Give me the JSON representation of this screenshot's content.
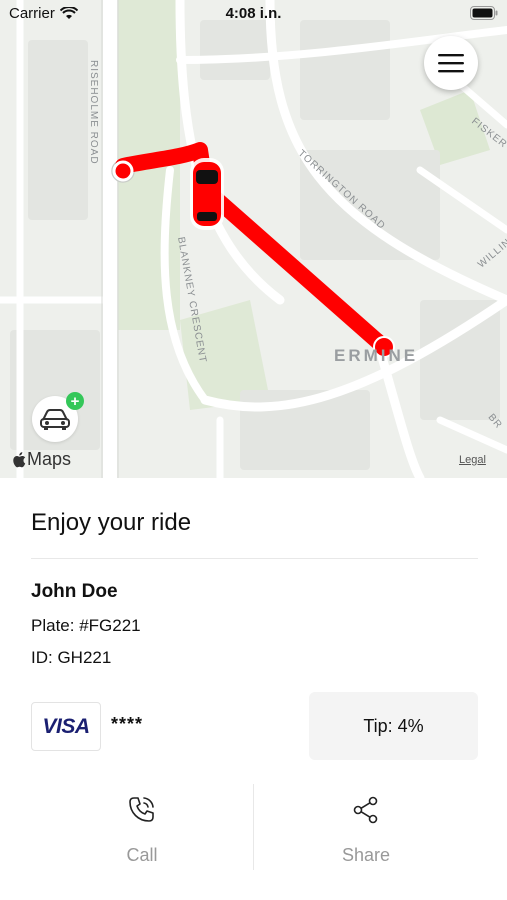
{
  "status_bar": {
    "carrier": "Carrier",
    "time": "4:08 i.n."
  },
  "map": {
    "streets": {
      "risholme": "RISEHOLME ROAD",
      "torrington": "TORRINGTON ROAD",
      "blankney": "BLANKNEY CRESCENT",
      "fiskerton": "FISKER",
      "willingham": "WILLING",
      "cut": "BR"
    },
    "area_label": "ERMINE",
    "maps_logo_text": "Maps",
    "legal_link": "Legal",
    "route_color": "#ff0000"
  },
  "ride": {
    "title": "Enjoy your ride",
    "driver_name": "John Doe",
    "plate_label": "Plate: #FG221",
    "id_label": "ID: GH221",
    "card_brand": "VISA",
    "card_mask": "****",
    "tip_label": "Tip: 4%"
  },
  "actions": {
    "call_label": "Call",
    "share_label": "Share"
  }
}
